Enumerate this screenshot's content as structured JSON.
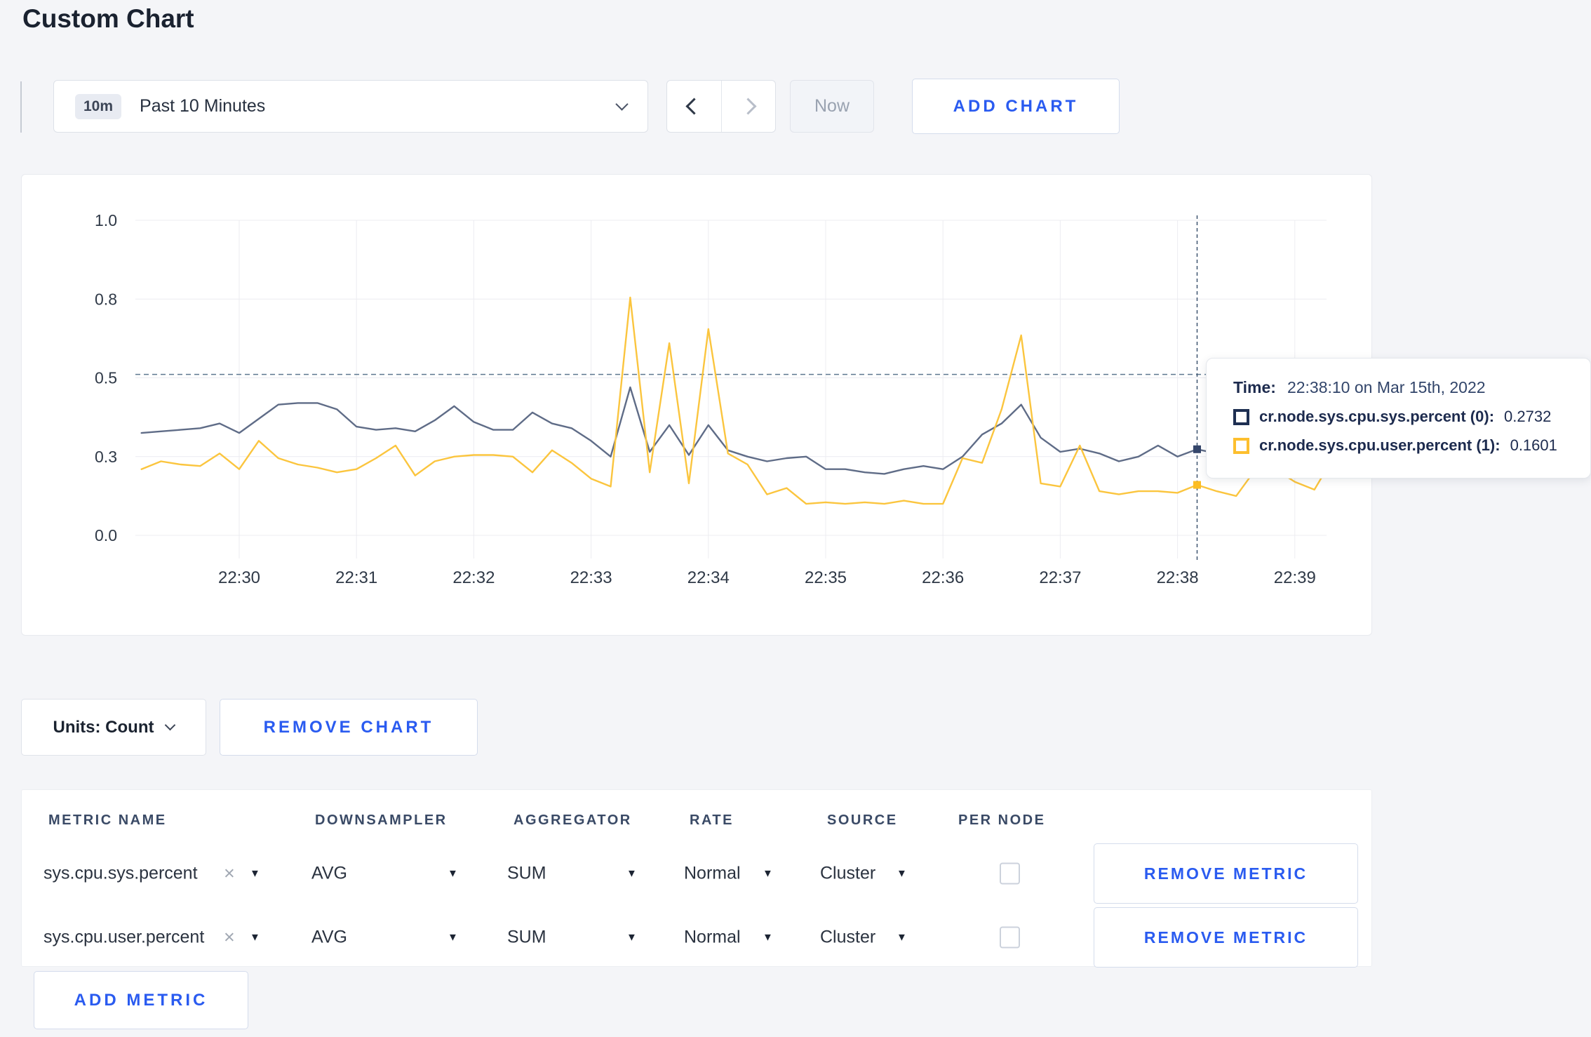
{
  "page": {
    "title": "Custom Chart"
  },
  "toolbar": {
    "time_range_badge": "10m",
    "time_range_label": "Past 10 Minutes",
    "now_label": "Now",
    "add_chart_label": "ADD CHART"
  },
  "chart_data": {
    "type": "line",
    "title": "",
    "xlabel": "",
    "ylabel": "",
    "ylim": [
      0,
      1
    ],
    "grid": true,
    "legend_position": "none",
    "y_tick_values": [
      0,
      0.25,
      0.5,
      0.75,
      1.0
    ],
    "y_tick_labels": [
      "0.0",
      "0.3",
      "0.5",
      "0.8",
      "1.0"
    ],
    "x_ticks": [
      "22:30",
      "22:31",
      "22:32",
      "22:33",
      "22:34",
      "22:35",
      "22:36",
      "22:37",
      "22:38",
      "22:39"
    ],
    "x_start_time": "22:29:10",
    "t0_minutes": -0.8333,
    "dt_minutes": 0.16667,
    "guide_value": 0.511,
    "crosshair_time": "22:38:10",
    "crosshair_minutes": 8.16667,
    "series": [
      {
        "name": "cr.node.sys.cpu.sys.percent",
        "color": "#5f6c87",
        "values": [
          0.325,
          0.33,
          0.335,
          0.34,
          0.355,
          0.325,
          0.37,
          0.415,
          0.42,
          0.42,
          0.4,
          0.345,
          0.335,
          0.34,
          0.33,
          0.365,
          0.41,
          0.36,
          0.335,
          0.335,
          0.39,
          0.355,
          0.34,
          0.3,
          0.25,
          0.47,
          0.265,
          0.35,
          0.255,
          0.35,
          0.27,
          0.25,
          0.235,
          0.245,
          0.25,
          0.21,
          0.21,
          0.2,
          0.195,
          0.21,
          0.22,
          0.21,
          0.25,
          0.32,
          0.355,
          0.415,
          0.31,
          0.265,
          0.275,
          0.26,
          0.235,
          0.25,
          0.285,
          0.25,
          0.2732,
          0.26,
          0.25,
          0.26,
          0.27,
          0.26,
          0.27,
          0.26
        ]
      },
      {
        "name": "cr.node.sys.cpu.user.percent",
        "color": "#fbc53e",
        "values": [
          0.21,
          0.235,
          0.225,
          0.22,
          0.26,
          0.21,
          0.3,
          0.245,
          0.225,
          0.215,
          0.2,
          0.21,
          0.245,
          0.285,
          0.19,
          0.235,
          0.25,
          0.255,
          0.255,
          0.25,
          0.2,
          0.27,
          0.23,
          0.18,
          0.155,
          0.755,
          0.2,
          0.61,
          0.165,
          0.655,
          0.26,
          0.225,
          0.13,
          0.15,
          0.1,
          0.105,
          0.1,
          0.105,
          0.1,
          0.11,
          0.1,
          0.1,
          0.245,
          0.23,
          0.4,
          0.635,
          0.165,
          0.155,
          0.285,
          0.14,
          0.13,
          0.14,
          0.14,
          0.135,
          0.1601,
          0.14,
          0.125,
          0.21,
          0.21,
          0.17,
          0.145,
          0.25
        ]
      }
    ],
    "crosshair_points": [
      {
        "value": 0.2732,
        "color": "#35466b"
      },
      {
        "value": 0.1601,
        "color": "#fcbd23"
      }
    ]
  },
  "tooltip": {
    "time_label": "Time:",
    "time_value": "22:38:10 on Mar 15th, 2022",
    "rows": [
      {
        "label": "cr.node.sys.cpu.sys.percent (0):",
        "value": "0.2732",
        "swatch": "#1e2f52"
      },
      {
        "label": "cr.node.sys.cpu.user.percent (1):",
        "value": "0.1601",
        "swatch": "#fdbf2e"
      }
    ]
  },
  "chart_controls": {
    "units_label": "Units: Count",
    "remove_chart_label": "REMOVE CHART"
  },
  "metrics_table": {
    "headers": [
      "METRIC NAME",
      "DOWNSAMPLER",
      "AGGREGATOR",
      "RATE",
      "SOURCE",
      "PER NODE"
    ],
    "icons": {
      "caret": "▼",
      "remove_x": "×"
    },
    "rows": [
      {
        "metric": "sys.cpu.sys.percent",
        "downsampler": "AVG",
        "aggregator": "SUM",
        "rate": "Normal",
        "source": "Cluster",
        "per_node_checked": false,
        "remove_label": "REMOVE METRIC"
      },
      {
        "metric": "sys.cpu.user.percent",
        "downsampler": "AVG",
        "aggregator": "SUM",
        "rate": "Normal",
        "source": "Cluster",
        "per_node_checked": false,
        "remove_label": "REMOVE METRIC"
      }
    ],
    "add_metric_label": "ADD METRIC"
  }
}
